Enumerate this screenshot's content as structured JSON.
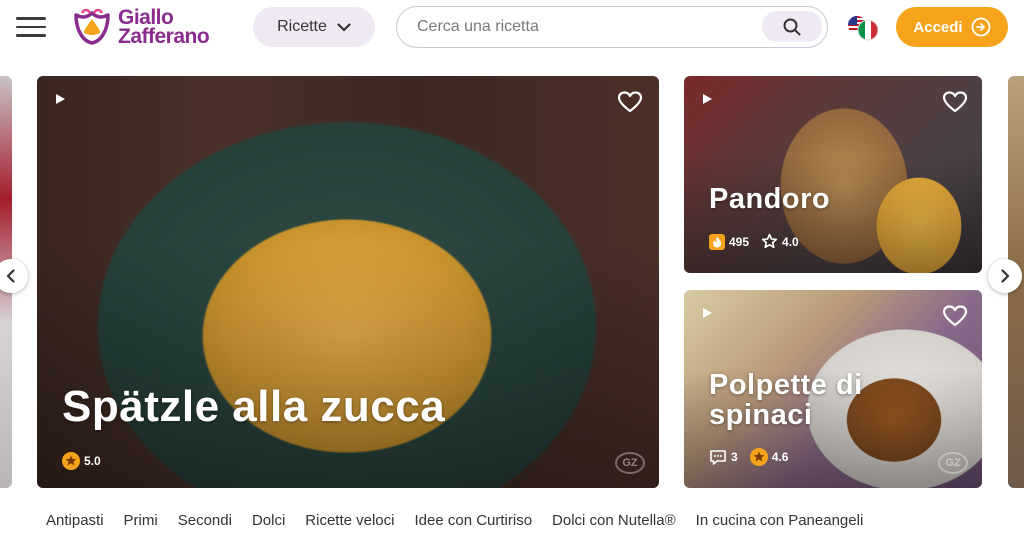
{
  "header": {
    "logo_text_line1": "Giallo",
    "logo_text_line2": "Zafferano",
    "recipes_button": "Ricette",
    "search_placeholder": "Cerca una ricetta",
    "login_button": "Accedi",
    "icons": [
      "menu-icon",
      "chevron-down-icon",
      "search-icon",
      "flag-icon",
      "login-arrow-icon"
    ]
  },
  "carousel": {
    "main": {
      "title": "Spätzle alla zucca",
      "rating": "5.0"
    },
    "side": [
      {
        "title": "Pandoro",
        "views": "495",
        "rating": "4.0"
      },
      {
        "title_line1": "Polpette di",
        "title_line2": "spinaci",
        "comments": "3",
        "rating": "4.6"
      }
    ],
    "watermark": "GZ"
  },
  "categories": [
    "Antipasti",
    "Primi",
    "Secondi",
    "Dolci",
    "Ricette veloci",
    "Idee con Curtiriso",
    "Dolci con Nutella®",
    "In cucina con Paneangeli"
  ],
  "colors": {
    "brand_purple": "#8a2b8f",
    "accent_orange": "#f6a31b",
    "chip_bg": "#efe9f4"
  }
}
